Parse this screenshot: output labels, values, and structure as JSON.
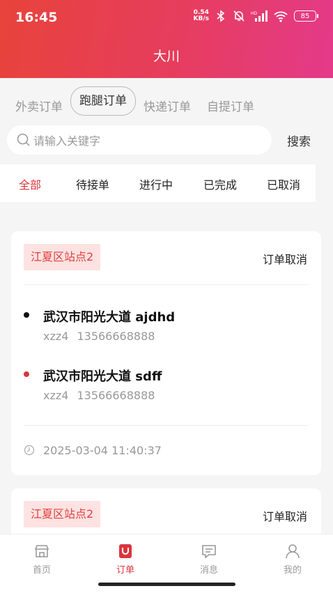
{
  "status_bar": {
    "time": "16:45",
    "net_speed_value": "0.54",
    "net_speed_unit": "KB/s",
    "signal_label": "HD",
    "battery": "85"
  },
  "header": {
    "title": "大川"
  },
  "order_types": [
    "外卖订单",
    "跑腿订单",
    "快递订单",
    "自提订单"
  ],
  "search": {
    "placeholder": "请输入关键字",
    "button": "搜索"
  },
  "status_tabs": [
    "全部",
    "待接单",
    "进行中",
    "已完成",
    "已取消"
  ],
  "orders": [
    {
      "station": "江夏区站点2",
      "status": "订单取消",
      "pickup": {
        "address": "武汉市阳光大道 ajdhd",
        "name": "xzz4",
        "phone": "13566668888"
      },
      "dropoff": {
        "address": "武汉市阳光大道 sdff",
        "name": "xzz4",
        "phone": "13566668888"
      },
      "time": "2025-03-04 11:40:37"
    },
    {
      "station": "江夏区站点2",
      "status": "订单取消"
    }
  ],
  "tabbar": [
    "首页",
    "订单",
    "消息",
    "我的"
  ],
  "colors": {
    "accent": "#d9363e",
    "header_start": "#e8433b",
    "header_end": "#e43a8a",
    "tag_bg": "#fde2e2"
  }
}
